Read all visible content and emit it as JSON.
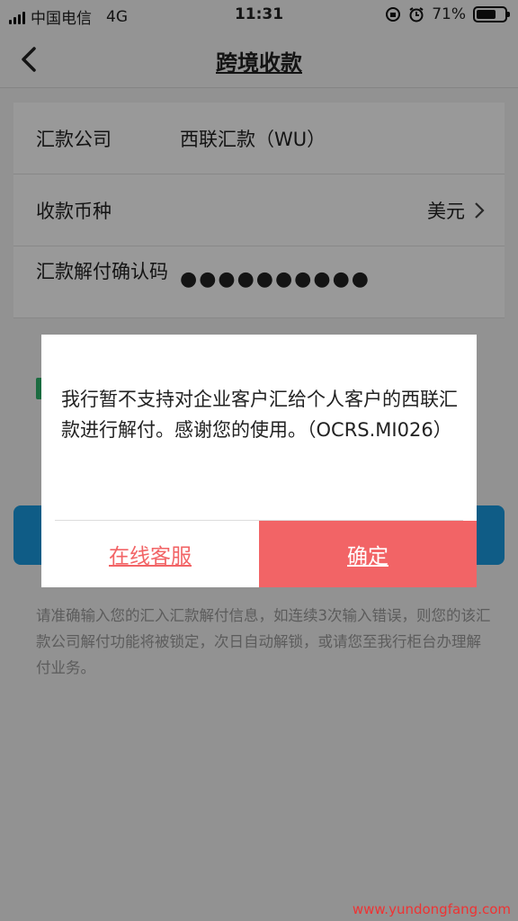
{
  "status_bar": {
    "carrier": "中国电信",
    "network": "4G",
    "time": "11:31",
    "battery": "71%",
    "battery_level": 0.71
  },
  "nav": {
    "title": "跨境收款"
  },
  "form": {
    "company_label": "汇款公司",
    "company_value": "西联汇款（WU）",
    "currency_label": "收款币种",
    "currency_value": "美元",
    "code_label": "汇款解付确认码",
    "code_value": "●●●●●●●●●●"
  },
  "hint": "请准确输入您的汇入汇款解付信息，如连续3次输入错误，则您的该汇款公司解付功能将被锁定，次日自动解锁，或请您至我行柜台办理解付业务。",
  "dialog": {
    "message": "我行暂不支持对企业客户汇给个人客户的西联汇款进行解付。感谢您的使用。（OCRS.MI026）",
    "customer_service": "在线客服",
    "confirm": "确定"
  },
  "watermark": "www.yundongfang.com",
  "colors": {
    "accent": "#f26466",
    "primary": "#1a9ae0",
    "check": "#2db36b"
  }
}
